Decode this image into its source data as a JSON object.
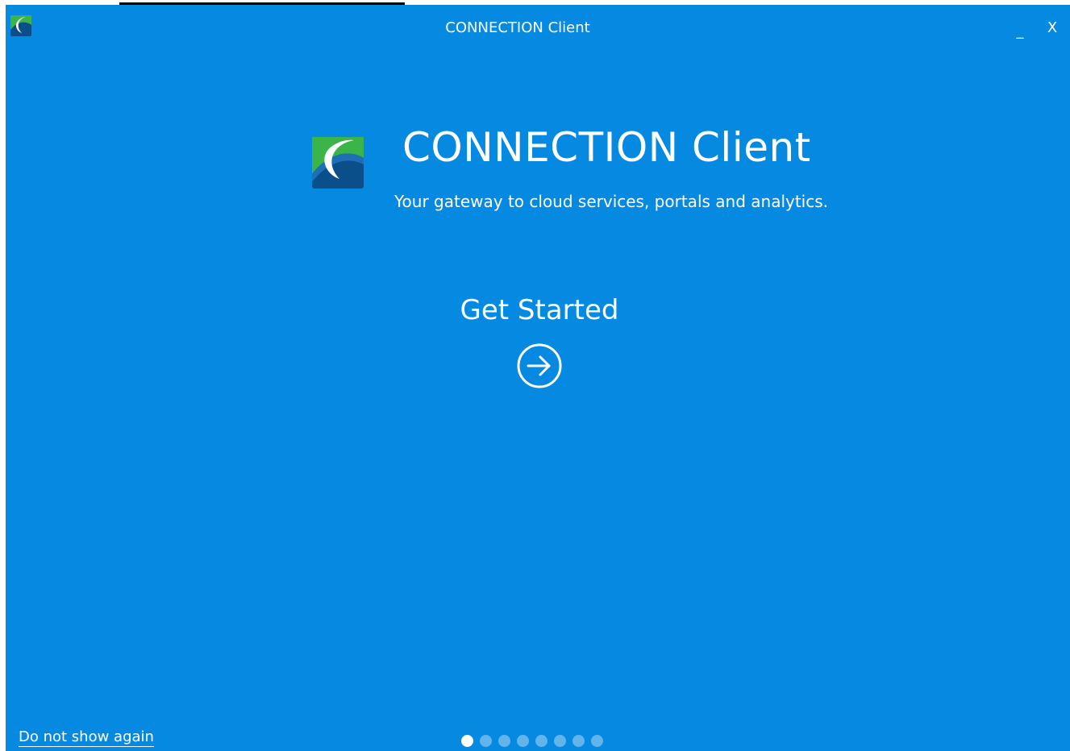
{
  "window": {
    "title": "CONNECTION Client",
    "minimize_label": "_",
    "close_label": "X"
  },
  "hero": {
    "headline": "CONNECTION Client",
    "tagline": "Your gateway to cloud services, portals and analytics."
  },
  "get_started": {
    "label": "Get Started",
    "icon": "arrow-right-circle-icon"
  },
  "footer": {
    "do_not_show_label": "Do not show again"
  },
  "pager": {
    "total": 8,
    "active_index": 0
  },
  "colors": {
    "background": "#0689e0",
    "text": "#ffffff",
    "logo_dark_blue": "#0b4f8a",
    "logo_green": "#3bb54a",
    "inactive_dot": "#64b4ec"
  }
}
